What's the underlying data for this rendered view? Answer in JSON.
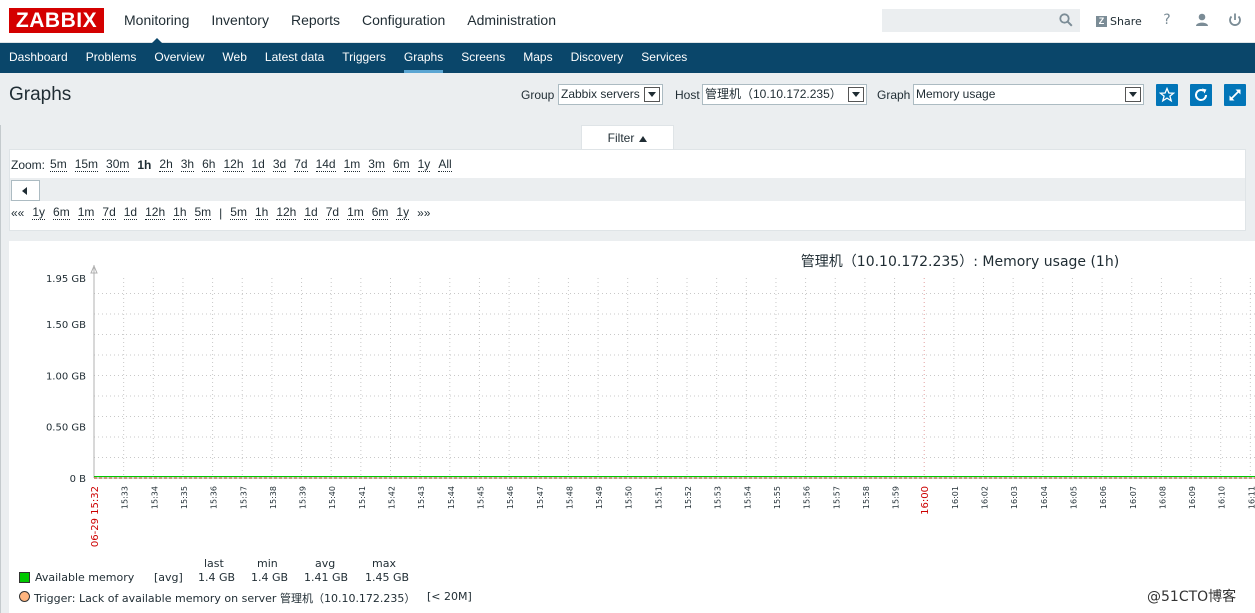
{
  "app": {
    "logo": "ZABBIX"
  },
  "top_nav": [
    "Monitoring",
    "Inventory",
    "Reports",
    "Configuration",
    "Administration"
  ],
  "header": {
    "share_label": "Share",
    "help": "?"
  },
  "sub_nav": [
    "Dashboard",
    "Problems",
    "Overview",
    "Web",
    "Latest data",
    "Triggers",
    "Graphs",
    "Screens",
    "Maps",
    "Discovery",
    "Services"
  ],
  "page": {
    "title": "Graphs",
    "group_label": "Group",
    "group_value": "Zabbix servers",
    "host_label": "Host",
    "host_value": "管理机（10.10.172.235）",
    "graph_label": "Graph",
    "graph_value": "Memory usage"
  },
  "filter": {
    "tab_label": "Filter",
    "zoom_label": "Zoom:",
    "zoom_options": [
      "5m",
      "15m",
      "30m",
      "1h",
      "2h",
      "3h",
      "6h",
      "12h",
      "1d",
      "3d",
      "7d",
      "14d",
      "1m",
      "3m",
      "6m",
      "1y",
      "All"
    ],
    "zoom_active": "1h",
    "nav_back_start": "««",
    "nav_back": [
      "1y",
      "6m",
      "1m",
      "7d",
      "1d",
      "12h",
      "1h",
      "5m"
    ],
    "nav_sep": "|",
    "nav_forward": [
      "5m",
      "1h",
      "12h",
      "1d",
      "7d",
      "1m",
      "6m",
      "1y"
    ],
    "nav_forward_end": "»»"
  },
  "chart_data": {
    "type": "line",
    "title": "管理机（10.10.172.235）: Memory usage (1h)",
    "y_ticks": [
      "0 B",
      "0.50 GB",
      "1.00 GB",
      "1.50 GB",
      "1.95 GB"
    ],
    "y_tick_values": [
      0,
      0.5,
      1.0,
      1.5,
      1.95
    ],
    "ylim": [
      0,
      1.95
    ],
    "x_ticks": [
      "06-29 15:32",
      "15:33",
      "15:34",
      "15:35",
      "15:36",
      "15:37",
      "15:38",
      "15:39",
      "15:40",
      "15:41",
      "15:42",
      "15:43",
      "15:44",
      "15:45",
      "15:46",
      "15:47",
      "15:48",
      "15:49",
      "15:50",
      "15:51",
      "15:52",
      "15:53",
      "15:54",
      "15:55",
      "15:56",
      "15:57",
      "15:58",
      "15:59",
      "16:00",
      "16:01",
      "16:02",
      "16:03",
      "16:04",
      "16:05",
      "16:06",
      "16:07",
      "16:08",
      "16:09",
      "16:10",
      "16:11"
    ],
    "x_ticks_highlighted": [
      "06-29 15:32",
      "16:00"
    ],
    "grid": true,
    "series": [
      {
        "name": "Available memory",
        "color": "#00c800",
        "stat_kind": "[avg]",
        "last": "1.4 GB",
        "min": "1.4 GB",
        "avg": "1.41 GB",
        "max": "1.45 GB"
      }
    ],
    "trigger": {
      "label": "Trigger: Lack of available memory on server 管理机（10.10.172.235）",
      "threshold": "[< 20M]",
      "color": "#ffb57f"
    },
    "legend_headers": [
      "last",
      "min",
      "avg",
      "max"
    ]
  },
  "watermark": "@51CTO博客",
  "colors": {
    "brand": "#d40000",
    "nav": "#0a466a",
    "accent": "#0275b8",
    "highlight_tick": "#cc0000"
  }
}
